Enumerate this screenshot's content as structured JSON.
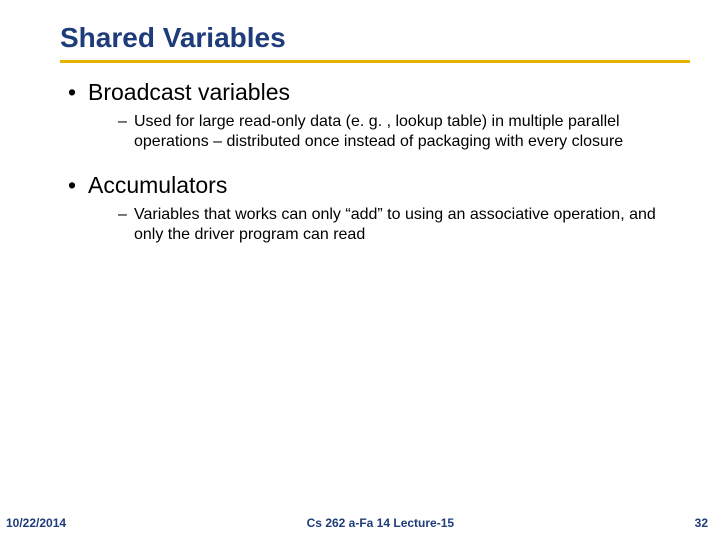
{
  "title": "Shared Variables",
  "b1": {
    "heading": "Broadcast variables",
    "sub": "Used for large read-only data (e. g. , lookup table) in multiple parallel operations – distributed once instead of packaging with every closure"
  },
  "b2": {
    "heading": "Accumulators",
    "sub": "Variables that works can only “add” to using an associative operation, and only the driver program can read"
  },
  "footer": {
    "date": "10/22/2014",
    "center": "Cs 262 a-Fa 14 Lecture-15",
    "page": "32"
  },
  "glyph": {
    "bullet": "•",
    "dash": "–"
  }
}
